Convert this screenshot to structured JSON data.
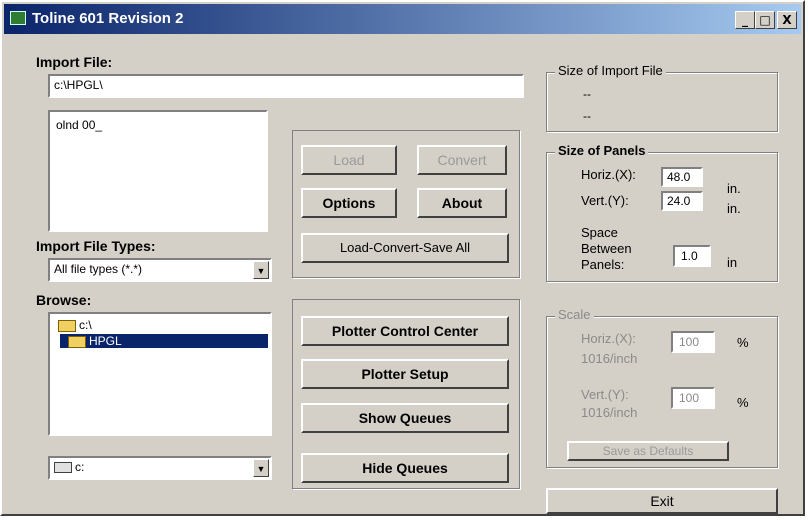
{
  "window": {
    "title": "Toline 601  Revision 2",
    "controls": {
      "minimize": "_",
      "maximize": "□",
      "close": "X"
    }
  },
  "import_file": {
    "label": "Import File:",
    "value": "c:\\HPGL\\",
    "list_items": [
      "olnd 00_"
    ]
  },
  "import_file_types": {
    "label": "Import File Types:",
    "selected": "All file types (*.*)"
  },
  "browse": {
    "label": "Browse:",
    "dirs": [
      "c:\\",
      "HPGL"
    ],
    "drive": "c:"
  },
  "buttons": {
    "load": "Load",
    "convert": "Convert",
    "options": "Options",
    "about": "About",
    "load_convert_save_all": "Load-Convert-Save All",
    "plotter_control_center": "Plotter Control Center",
    "plotter_setup": "Plotter Setup",
    "show_queues": "Show Queues",
    "hide_queues": "Hide Queues",
    "save_as_defaults": "Save as Defaults",
    "exit": "Exit"
  },
  "size_of_import_file": {
    "title": "Size of Import File",
    "line1": "--",
    "line2": "--"
  },
  "size_of_panels": {
    "title": "Size of Panels",
    "horiz_label": "Horiz.(X):",
    "horiz_value": "48.0",
    "horiz_unit": "in.",
    "vert_label": "Vert.(Y):",
    "vert_value": "24.0",
    "vert_unit": "in.",
    "space_label_1": "Space",
    "space_label_2": "Between",
    "space_label_3": "Panels:",
    "space_value": "1.0",
    "space_unit": "in"
  },
  "scale": {
    "title": "Scale",
    "horiz_label": "Horiz.(X):",
    "horiz_sub": "1016/inch",
    "horiz_value": "100",
    "horiz_unit": "%",
    "vert_label": "Vert.(Y):",
    "vert_sub": "1016/inch",
    "vert_value": "100",
    "vert_unit": "%"
  }
}
